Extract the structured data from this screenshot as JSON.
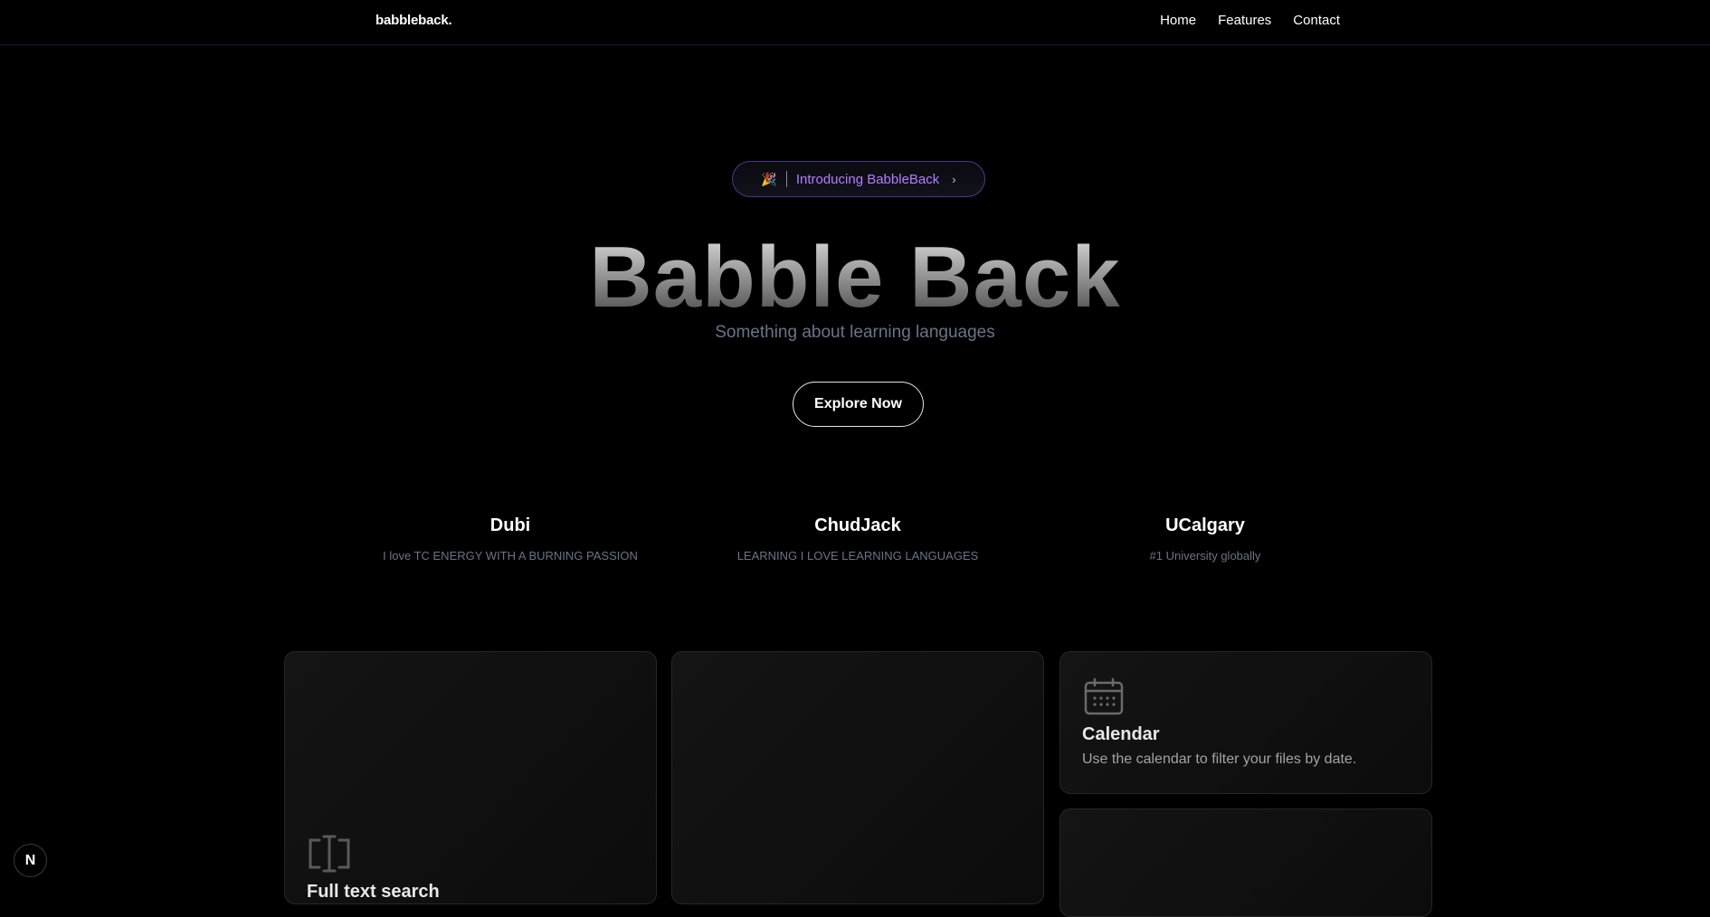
{
  "nav": {
    "brand": "babbleback.",
    "links": [
      "Home",
      "Features",
      "Contact"
    ]
  },
  "hero": {
    "badge_emoji": "🎉",
    "badge_text": "Introducing BabbleBack",
    "badge_chevron": "›",
    "title": "Babble Back",
    "subtitle": "Something about learning languages",
    "cta": "Explore Now"
  },
  "stats": [
    {
      "title": "Dubi",
      "desc": "I love TC ENERGY WITH A BURNING PASSION"
    },
    {
      "title": "ChudJack",
      "desc": "LEARNING I LOVE LEARNING LANGUAGES"
    },
    {
      "title": "UCalgary",
      "desc": "#1 University globally"
    }
  ],
  "cards": {
    "fulltext_title": "Full text search",
    "calendar_title": "Calendar",
    "calendar_desc": "Use the calendar to filter your files by date."
  },
  "dev_badge": "N",
  "colors": {
    "accent_purple": "#b47dff",
    "muted_text": "#6b7388",
    "background": "#000000"
  }
}
